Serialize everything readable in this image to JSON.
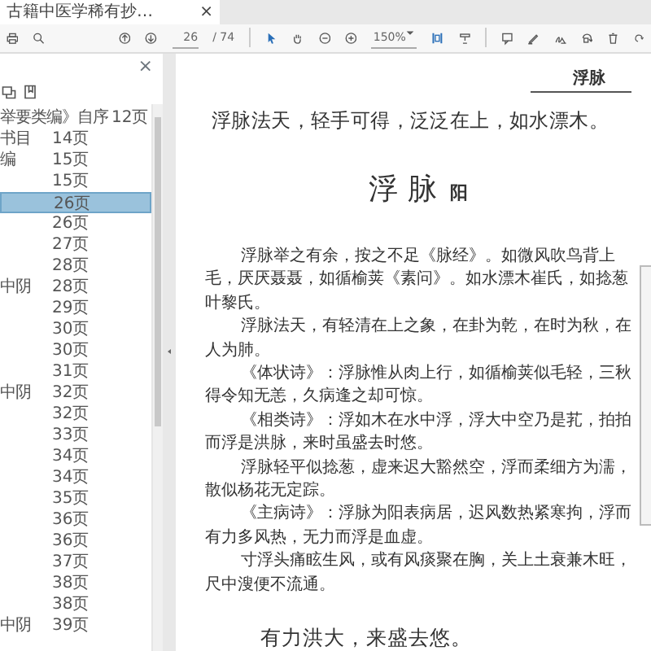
{
  "tab": {
    "title": "古籍中医学稀有抄…",
    "close": "×"
  },
  "toolbar": {
    "page": "26",
    "page_count": "/ 74",
    "zoom": "150%"
  },
  "sidebar": {
    "close": "×",
    "items": [
      {
        "label": "举要类编》自序",
        "page": "12页",
        "selected": false
      },
      {
        "label": "书目",
        "page": "14页",
        "selected": false
      },
      {
        "label": "编",
        "page": "15页",
        "selected": false
      },
      {
        "page": "15页",
        "selected": false
      },
      {
        "page": "26页",
        "selected": true
      },
      {
        "page": "26页",
        "selected": false
      },
      {
        "page": "27页",
        "selected": false
      },
      {
        "page": "28页",
        "selected": false
      },
      {
        "label": "中阴",
        "page": "28页",
        "selected": false
      },
      {
        "page": "29页",
        "selected": false
      },
      {
        "page": "30页",
        "selected": false
      },
      {
        "page": "30页",
        "selected": false
      },
      {
        "page": "31页",
        "selected": false
      },
      {
        "label": "中阴",
        "page": "32页",
        "selected": false
      },
      {
        "page": "32页",
        "selected": false
      },
      {
        "page": "33页",
        "selected": false
      },
      {
        "page": "34页",
        "selected": false
      },
      {
        "page": "34页",
        "selected": false
      },
      {
        "page": "35页",
        "selected": false
      },
      {
        "page": "36页",
        "selected": false
      },
      {
        "page": "36页",
        "selected": false
      },
      {
        "page": "37页",
        "selected": false
      },
      {
        "page": "38页",
        "selected": false
      },
      {
        "page": "38页",
        "selected": false
      },
      {
        "label": "中阴",
        "page": "39页",
        "selected": false
      }
    ]
  },
  "document": {
    "running_head": "浮脉",
    "verse": "浮脉法天，轻手可得，泛泛在上，如水漂木。",
    "title": "浮 脉",
    "title_note": "阳",
    "paragraphs": [
      "浮脉举之有余，按之不足《脉经》。如微风吹鸟背上毛，厌厌聂聂，如循榆荚《素问》。如水漂木崔氏，如捻葱叶黎氏。",
      "浮脉法天，有轻清在上之象，在卦为乾，在时为秋，在人为肺。",
      "《体状诗》：浮脉惟从肉上行，如循榆荚似毛轻，三秋得令知无恙，久病逢之却可惊。",
      "《相类诗》：浮如木在水中浮，浮大中空乃是芤，拍拍而浮是洪脉，来时虽盛去时悠。",
      "浮脉轻平似捻葱，虚来迟大豁然空，浮而柔细方为濡，散似杨花无定踪。",
      "《主病诗》：浮脉为阳表病居，迟风数热紧寒拘，浮而有力多风热，无力而浮是血虚。",
      "寸浮头痛眩生风，或有风痰聚在胸，关上土衰兼木旺，尺中溲便不流通。"
    ],
    "closing_verse": "有力洪大，来盛去悠。"
  }
}
